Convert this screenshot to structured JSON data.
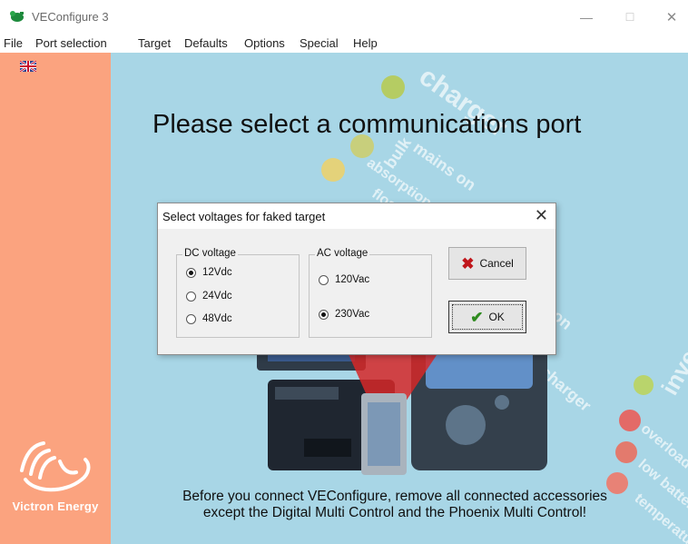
{
  "window": {
    "title": "VEConfigure 3",
    "minimize_glyph": "—",
    "maximize_glyph": "☐",
    "close_glyph": "✕"
  },
  "menu": {
    "items": [
      "File",
      "Port selection",
      "Target",
      "Defaults",
      "Options",
      "Special",
      "Help"
    ]
  },
  "sidebar": {
    "language_icon": "uk-flag-icon",
    "logo_icon": "victron-logo-icon",
    "brand": "Victron Energy"
  },
  "main": {
    "heading": "Please select a communications port",
    "footer_line1": "Before you connect VEConfigure, remove all connected accessories",
    "footer_line2": "except the Digital Multi Control and the Phoenix Multi Control!",
    "background_words": [
      "charger",
      "mains on",
      "bulk",
      "absorption",
      "float",
      "inverter",
      "charger",
      "overload",
      "low battery",
      "temperature",
      "on"
    ]
  },
  "dialog": {
    "title": "Select voltages for faked target",
    "close_glyph": "✕",
    "dc_group": {
      "label": "DC voltage",
      "options": [
        "12Vdc",
        "24Vdc",
        "48Vdc"
      ],
      "selected": "12Vdc"
    },
    "ac_group": {
      "label": "AC voltage",
      "options": [
        "120Vac",
        "230Vac"
      ],
      "selected": "230Vac"
    },
    "cancel_label": "Cancel",
    "ok_label": "OK"
  },
  "colors": {
    "sidebar": "#fba37f",
    "client_bg": "#a8d6e6",
    "cancel_icon": "#c0161b",
    "ok_icon": "#2e8b1f"
  }
}
